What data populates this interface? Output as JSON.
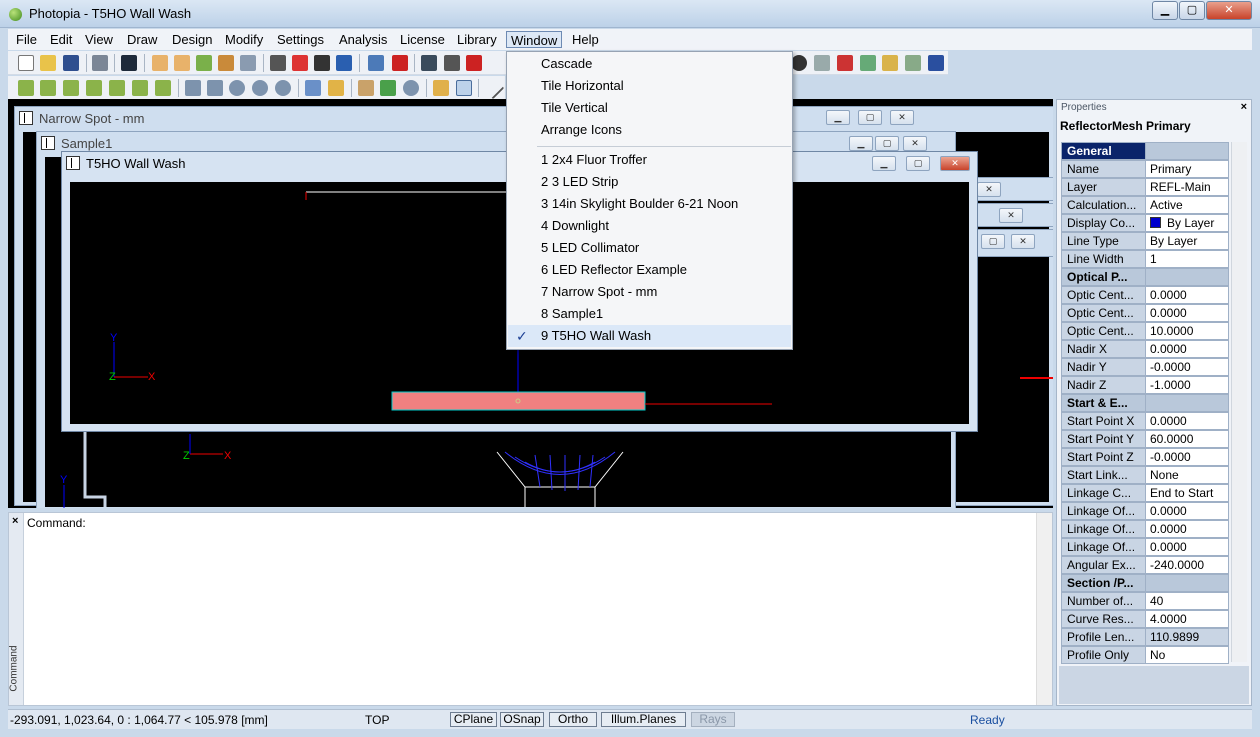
{
  "app": {
    "title": "Photopia - T5HO Wall Wash",
    "caption_buttons": {
      "minimize": "▁",
      "maximize": "▢",
      "close": "✕"
    }
  },
  "menubar": [
    "File",
    "Edit",
    "View",
    "Draw",
    "Design",
    "Modify",
    "Settings",
    "Analysis",
    "License",
    "Library",
    "Window",
    "Help"
  ],
  "window_menu": {
    "items": [
      "Cascade",
      "Tile Horizontal",
      "Tile Vertical",
      "Arrange Icons"
    ],
    "windows": [
      "1 2x4 Fluor Troffer",
      "2 3 LED Strip",
      "3 14in Skylight Boulder 6-21 Noon",
      "4 Downlight",
      "5 LED Collimator",
      "6 LED Reflector Example",
      "7 Narrow Spot - mm",
      "8 Sample1",
      "9 T5HO Wall Wash"
    ],
    "checked_index": 8,
    "checkmark": "✓"
  },
  "child_windows": {
    "narrow_spot": "Narrow Spot - mm",
    "sample1": "Sample1",
    "t5ho": "T5HO Wall Wash"
  },
  "axes": {
    "y": "Y",
    "z": "Z",
    "x": "X"
  },
  "command": {
    "label": "Command:",
    "side_label": "Command",
    "close": "×"
  },
  "properties": {
    "header": "Properties",
    "close": "×",
    "object": "ReflectorMesh Primary",
    "rows": [
      {
        "name": "General",
        "value": "",
        "section": true
      },
      {
        "name": "Name",
        "value": "Primary"
      },
      {
        "name": "Layer",
        "value": "REFL-Main"
      },
      {
        "name": "Calculation...",
        "value": "Active"
      },
      {
        "name": "Display Co...",
        "value": "By Layer",
        "swatch": "#0000cc"
      },
      {
        "name": "Line Type",
        "value": "By Layer"
      },
      {
        "name": "Line Width",
        "value": "1"
      },
      {
        "name": "Optical P...",
        "value": "",
        "section": true
      },
      {
        "name": "Optic Cent...",
        "value": "0.0000"
      },
      {
        "name": "Optic Cent...",
        "value": "0.0000"
      },
      {
        "name": "Optic Cent...",
        "value": "10.0000"
      },
      {
        "name": "Nadir X",
        "value": "0.0000"
      },
      {
        "name": "Nadir Y",
        "value": "-0.0000"
      },
      {
        "name": "Nadir Z",
        "value": "-1.0000"
      },
      {
        "name": "Start & E...",
        "value": "",
        "section": true
      },
      {
        "name": "Start Point X",
        "value": "0.0000"
      },
      {
        "name": "Start Point Y",
        "value": "60.0000"
      },
      {
        "name": "Start Point Z",
        "value": "-0.0000"
      },
      {
        "name": "Start Link...",
        "value": "None"
      },
      {
        "name": "Linkage C...",
        "value": "End to Start"
      },
      {
        "name": "Linkage Of...",
        "value": "0.0000"
      },
      {
        "name": "Linkage Of...",
        "value": "0.0000"
      },
      {
        "name": "Linkage Of...",
        "value": "0.0000"
      },
      {
        "name": "Angular Ex...",
        "value": "-240.0000"
      },
      {
        "name": "Section /P...",
        "value": "",
        "section": true
      },
      {
        "name": "Number of...",
        "value": "40"
      },
      {
        "name": "Curve Res...",
        "value": "4.0000"
      },
      {
        "name": "Profile Len...",
        "value": "110.9899",
        "gray": true
      },
      {
        "name": "Profile Only",
        "value": "No"
      }
    ]
  },
  "status": {
    "coords": "-293.091, 1,023.64, 0 : 1,064.77 < 105.978 [mm]",
    "view": "TOP",
    "toggles": [
      {
        "label": "CPlane",
        "on": true
      },
      {
        "label": "OSnap",
        "on": true
      },
      {
        "label": "Ortho",
        "on": true
      },
      {
        "label": "Illum.Planes",
        "on": true
      },
      {
        "label": "Rays",
        "on": false
      }
    ],
    "state": "Ready"
  },
  "colors": {
    "accent": "#0a246a",
    "reflector_fill": "#f08080",
    "status_ready": "#1a4fa0"
  }
}
